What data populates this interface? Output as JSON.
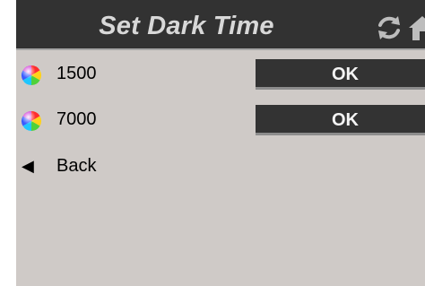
{
  "header": {
    "title": "Set Dark Time",
    "refresh_icon": "refresh-icon",
    "home_icon": "home-icon"
  },
  "rows": [
    {
      "icon": "color-wheel-icon",
      "value": "1500",
      "button_label": "OK"
    },
    {
      "icon": "color-wheel-icon",
      "value": "7000",
      "button_label": "OK"
    }
  ],
  "back": {
    "arrow": "◀",
    "label": "Back"
  },
  "colors": {
    "header_bg": "#323232",
    "screen_bg": "#cfcac7",
    "button_bg": "#333333",
    "title_text": "#d8d8d8"
  }
}
